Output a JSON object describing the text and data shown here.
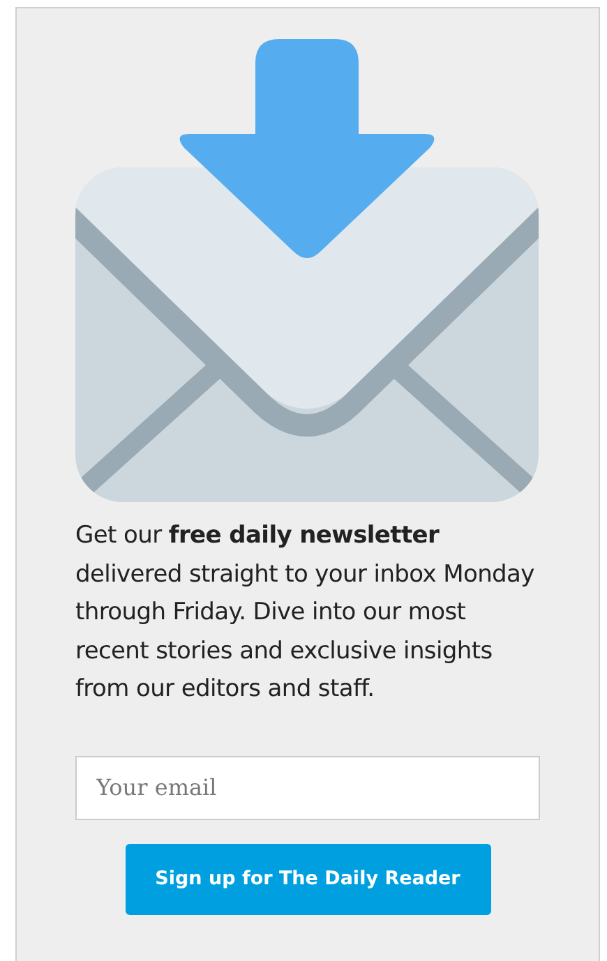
{
  "description": "Get our **free daily newsletter** delivered straight to your inbox Monday through Friday. Dive into our most recent stories and exclusive insights from our editors and staff.",
  "email_field": {
    "placeholder": "Your email"
  },
  "signup_button": {
    "label": "Sign up for The Daily Reader"
  }
}
